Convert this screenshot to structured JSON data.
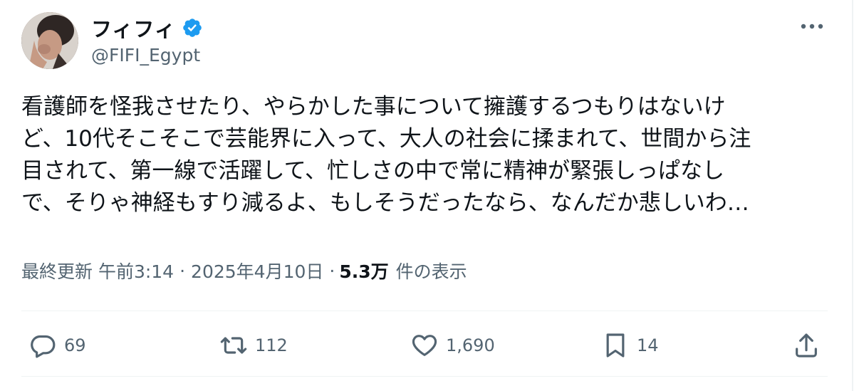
{
  "author": {
    "display_name": "フィフィ",
    "handle": "@FIFI_Egypt",
    "verified": true
  },
  "tweet": {
    "text_lines": [
      "看護師を怪我させたり、やらかした事について擁護するつもりはないけ",
      "ど、10代そこそこで芸能界に入って、大人の社会に揉まれて、世間から注",
      "目されて、第一線で活躍して、忙しさの中で常に精神が緊張しっぱなし",
      "で、そりゃ神経もすり減るよ、もしそうだったなら、なんだか悲しいわ…"
    ]
  },
  "meta": {
    "updated_label": "最終更新 午前3:14",
    "separator": "·",
    "date": "2025年4月10日",
    "views_count": "5.3万",
    "views_label": "件の表示"
  },
  "actions": {
    "replies": "69",
    "reposts": "112",
    "likes": "1,690",
    "bookmarks": "14"
  },
  "icons": {
    "verified": "verified-badge-icon",
    "more": "more-horizontal-icon",
    "reply": "reply-bubble-icon",
    "repost": "repost-icon",
    "like": "heart-icon",
    "bookmark": "bookmark-icon",
    "share": "share-icon"
  },
  "colors": {
    "verified_blue": "#1d9bf0",
    "text": "#0f1419",
    "secondary": "#536471",
    "divider": "#eff3f4"
  }
}
